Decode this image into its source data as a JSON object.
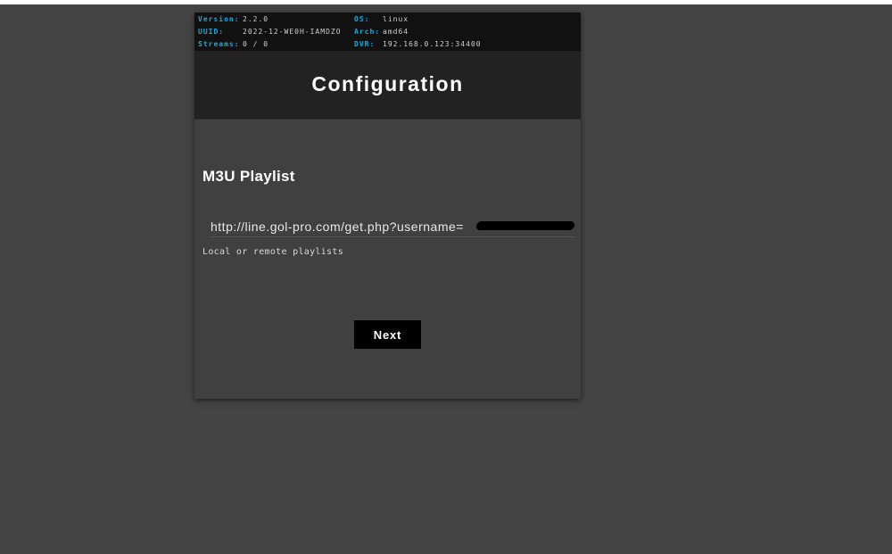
{
  "info": {
    "version_label": "Version:",
    "version_value": "2.2.0",
    "uuid_label": "UUID:",
    "uuid_value": "2022-12-WE0H-IAMDZO",
    "streams_label": "Streams:",
    "streams_value": "0 / 0",
    "os_label": "OS:",
    "os_value": "linux",
    "arch_label": "Arch:",
    "arch_value": "amd64",
    "dvr_label": "DVR:",
    "dvr_value": "192.168.0.123:34400"
  },
  "header": {
    "title": "Configuration"
  },
  "playlist": {
    "section_title": "M3U Playlist",
    "input_value": "http://line.gol-pro.com/get.php?username=",
    "helper_text": "Local or remote playlists"
  },
  "actions": {
    "next_label": "Next"
  },
  "colors": {
    "background": "#444444",
    "info_key": "#1fa7d6",
    "header_bg": "#222222",
    "button_bg": "#000000"
  }
}
